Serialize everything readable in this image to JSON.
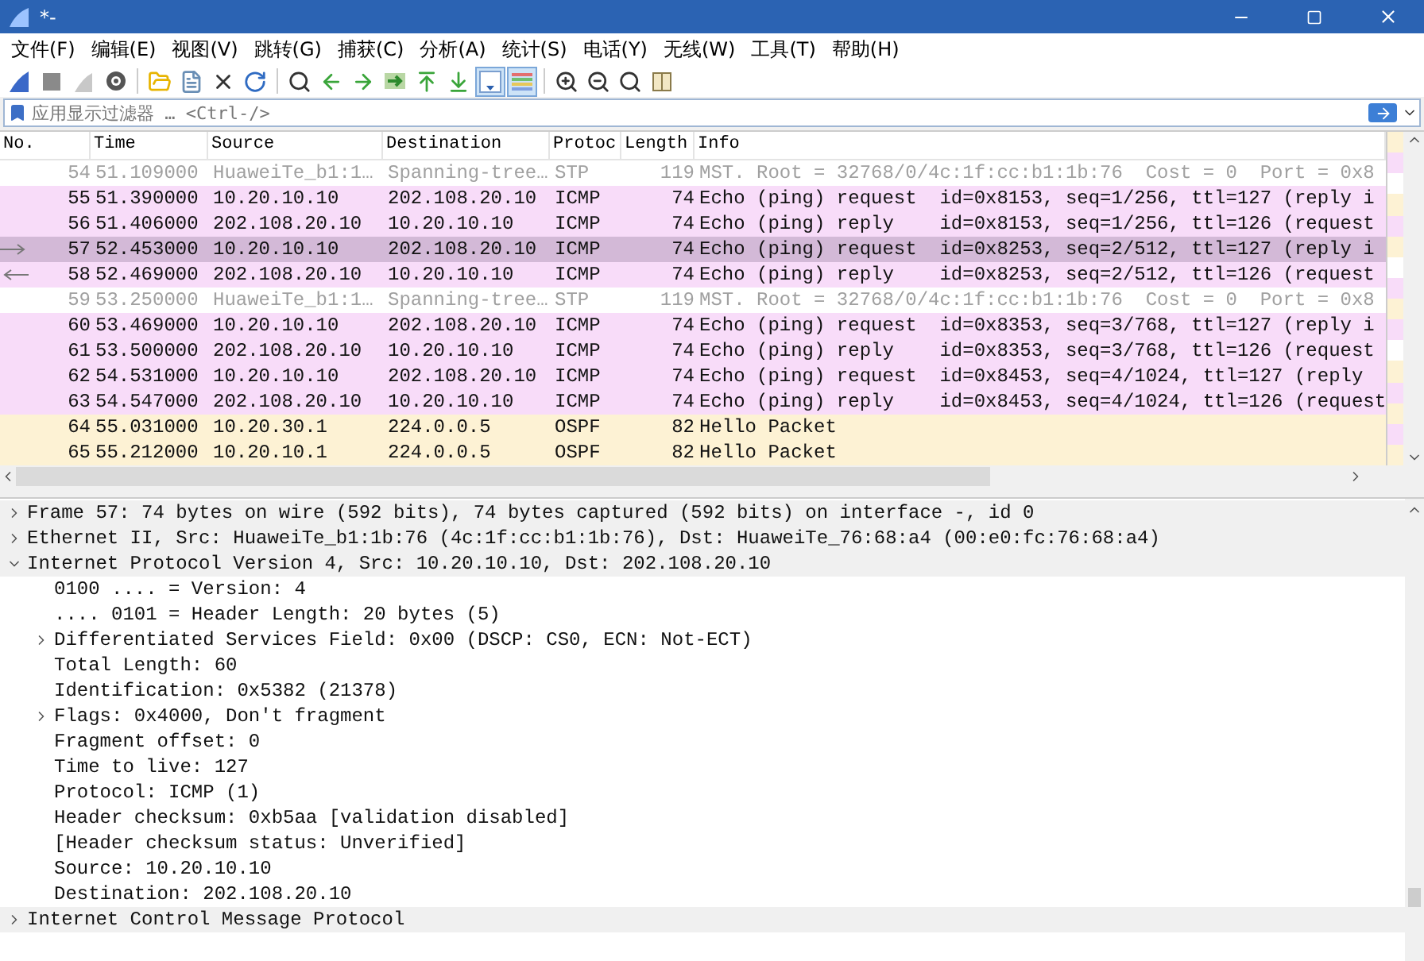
{
  "window": {
    "title": "*-"
  },
  "menu": [
    "文件(F)",
    "编辑(E)",
    "视图(V)",
    "跳转(G)",
    "捕获(C)",
    "分析(A)",
    "统计(S)",
    "电话(Y)",
    "无线(W)",
    "工具(T)",
    "帮助(H)"
  ],
  "toolbar": [
    [
      {
        "kind": "fin",
        "on": false
      },
      {
        "kind": "stop",
        "on": false
      },
      {
        "kind": "restart",
        "on": false
      },
      {
        "kind": "options",
        "on": false
      }
    ],
    [
      {
        "kind": "open",
        "on": false
      },
      {
        "kind": "file",
        "on": false
      },
      {
        "kind": "close",
        "on": false
      },
      {
        "kind": "reload",
        "on": false
      }
    ],
    [
      {
        "kind": "find",
        "on": false
      },
      {
        "kind": "back",
        "on": false
      },
      {
        "kind": "forward",
        "on": false
      },
      {
        "kind": "goto",
        "on": false
      },
      {
        "kind": "first",
        "on": false
      },
      {
        "kind": "last",
        "on": false
      },
      {
        "kind": "autoscroll",
        "on": true
      },
      {
        "kind": "colorize",
        "on": true
      }
    ],
    [
      {
        "kind": "zoomin",
        "on": false
      },
      {
        "kind": "zoomout",
        "on": false
      },
      {
        "kind": "zoomreset",
        "on": false
      },
      {
        "kind": "columns",
        "on": false
      }
    ]
  ],
  "filter": {
    "placeholder": "应用显示过滤器 … <Ctrl-/>"
  },
  "packet_list": {
    "columns": [
      "No.",
      "Time",
      "Source",
      "Destination",
      "Protoc",
      "Length",
      "Info"
    ],
    "rows": [
      {
        "no": "54",
        "time": "51.109000",
        "source": "HuaweiTe_b1:1…",
        "destination": "Spanning-tree…",
        "protocol": "STP",
        "length": "119",
        "info": "MST. Root = 32768/0/4c:1f:cc:b1:1b:76  Cost = 0  Port = 0x8",
        "kind": "stp",
        "selected": false,
        "request_arrow": false,
        "reply_arrow": false
      },
      {
        "no": "55",
        "time": "51.390000",
        "source": "10.20.10.10",
        "destination": "202.108.20.10",
        "protocol": "ICMP",
        "length": "74",
        "info": "Echo (ping) request  id=0x8153, seq=1/256, ttl=127 (reply i",
        "kind": "icmp",
        "selected": false,
        "request_arrow": false,
        "reply_arrow": false
      },
      {
        "no": "56",
        "time": "51.406000",
        "source": "202.108.20.10",
        "destination": "10.20.10.10",
        "protocol": "ICMP",
        "length": "74",
        "info": "Echo (ping) reply    id=0x8153, seq=1/256, ttl=126 (request",
        "kind": "icmp",
        "selected": false,
        "request_arrow": false,
        "reply_arrow": false
      },
      {
        "no": "57",
        "time": "52.453000",
        "source": "10.20.10.10",
        "destination": "202.108.20.10",
        "protocol": "ICMP",
        "length": "74",
        "info": "Echo (ping) request  id=0x8253, seq=2/512, ttl=127 (reply i",
        "kind": "icmp",
        "selected": true,
        "request_arrow": true,
        "reply_arrow": false
      },
      {
        "no": "58",
        "time": "52.469000",
        "source": "202.108.20.10",
        "destination": "10.20.10.10",
        "protocol": "ICMP",
        "length": "74",
        "info": "Echo (ping) reply    id=0x8253, seq=2/512, ttl=126 (request",
        "kind": "icmp",
        "selected": false,
        "request_arrow": false,
        "reply_arrow": true
      },
      {
        "no": "59",
        "time": "53.250000",
        "source": "HuaweiTe_b1:1…",
        "destination": "Spanning-tree…",
        "protocol": "STP",
        "length": "119",
        "info": "MST. Root = 32768/0/4c:1f:cc:b1:1b:76  Cost = 0  Port = 0x8",
        "kind": "stp",
        "selected": false,
        "request_arrow": false,
        "reply_arrow": false
      },
      {
        "no": "60",
        "time": "53.469000",
        "source": "10.20.10.10",
        "destination": "202.108.20.10",
        "protocol": "ICMP",
        "length": "74",
        "info": "Echo (ping) request  id=0x8353, seq=3/768, ttl=127 (reply i",
        "kind": "icmp",
        "selected": false,
        "request_arrow": false,
        "reply_arrow": false
      },
      {
        "no": "61",
        "time": "53.500000",
        "source": "202.108.20.10",
        "destination": "10.20.10.10",
        "protocol": "ICMP",
        "length": "74",
        "info": "Echo (ping) reply    id=0x8353, seq=3/768, ttl=126 (request",
        "kind": "icmp",
        "selected": false,
        "request_arrow": false,
        "reply_arrow": false
      },
      {
        "no": "62",
        "time": "54.531000",
        "source": "10.20.10.10",
        "destination": "202.108.20.10",
        "protocol": "ICMP",
        "length": "74",
        "info": "Echo (ping) request  id=0x8453, seq=4/1024, ttl=127 (reply",
        "kind": "icmp",
        "selected": false,
        "request_arrow": false,
        "reply_arrow": false
      },
      {
        "no": "63",
        "time": "54.547000",
        "source": "202.108.20.10",
        "destination": "10.20.10.10",
        "protocol": "ICMP",
        "length": "74",
        "info": "Echo (ping) reply    id=0x8453, seq=4/1024, ttl=126 (request",
        "kind": "icmp",
        "selected": false,
        "request_arrow": false,
        "reply_arrow": false
      },
      {
        "no": "64",
        "time": "55.031000",
        "source": "10.20.30.1",
        "destination": "224.0.0.5",
        "protocol": "OSPF",
        "length": "82",
        "info": "Hello Packet",
        "kind": "ospf",
        "selected": false,
        "request_arrow": false,
        "reply_arrow": false
      },
      {
        "no": "65",
        "time": "55.212000",
        "source": "10.20.10.1",
        "destination": "224.0.0.5",
        "protocol": "OSPF",
        "length": "82",
        "info": "Hello Packet",
        "kind": "ospf",
        "selected": false,
        "request_arrow": false,
        "reply_arrow": false
      }
    ]
  },
  "details": [
    {
      "text": "Frame 57: 74 bytes on wire (592 bits), 74 bytes captured (592 bits) on interface -, id 0",
      "expanded": false
    },
    {
      "text": "Ethernet II, Src: HuaweiTe_b1:1b:76 (4c:1f:cc:b1:1b:76), Dst: HuaweiTe_76:68:a4 (00:e0:fc:76:68:a4)",
      "expanded": false
    },
    {
      "text": "Internet Protocol Version 4, Src: 10.20.10.10, Dst: 202.108.20.10",
      "expanded": true,
      "children": [
        {
          "text": "0100 .... = Version: 4"
        },
        {
          "text": ".... 0101 = Header Length: 20 bytes (5)"
        },
        {
          "text": "Differentiated Services Field: 0x00 (DSCP: CS0, ECN: Not-ECT)",
          "expanded": false
        },
        {
          "text": "Total Length: 60"
        },
        {
          "text": "Identification: 0x5382 (21378)"
        },
        {
          "text": "Flags: 0x4000, Don't fragment",
          "expanded": false
        },
        {
          "text": "Fragment offset: 0"
        },
        {
          "text": "Time to live: 127"
        },
        {
          "text": "Protocol: ICMP (1)"
        },
        {
          "text": "Header checksum: 0xb5aa [validation disabled]"
        },
        {
          "text": "[Header checksum status: Unverified]"
        },
        {
          "text": "Source: 10.20.10.10"
        },
        {
          "text": "Destination: 202.108.20.10"
        }
      ]
    },
    {
      "text": "Internet Control Message Protocol",
      "expanded": false
    }
  ]
}
